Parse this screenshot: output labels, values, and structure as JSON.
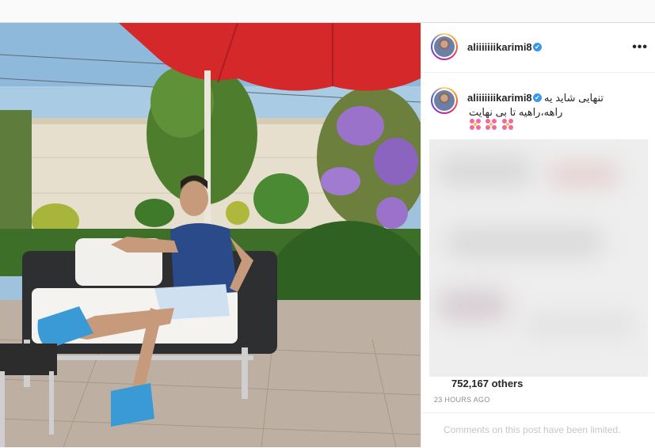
{
  "post": {
    "author": "aliiiiiiikarimi8",
    "caption_line1": "تنهایی شاید یه",
    "caption_line2": "راهه،راهیه تا بی نهایت",
    "likes_text": "752,167 others",
    "timestamp": "23 HOURS AGO",
    "comments_notice": "Comments on this post have been limited.",
    "verified_glyph": "✔",
    "more_glyph": "•••",
    "emoji_count": 3
  },
  "icons": {
    "verified": "verified-badge-icon",
    "more": "more-options-icon",
    "emoji": "hibiscus-flower-emoji"
  },
  "colors": {
    "verified": "#3897f0",
    "timestamp": "#8e8e8e",
    "notice": "#c7c7c7",
    "umbrella": "#d4282a"
  }
}
